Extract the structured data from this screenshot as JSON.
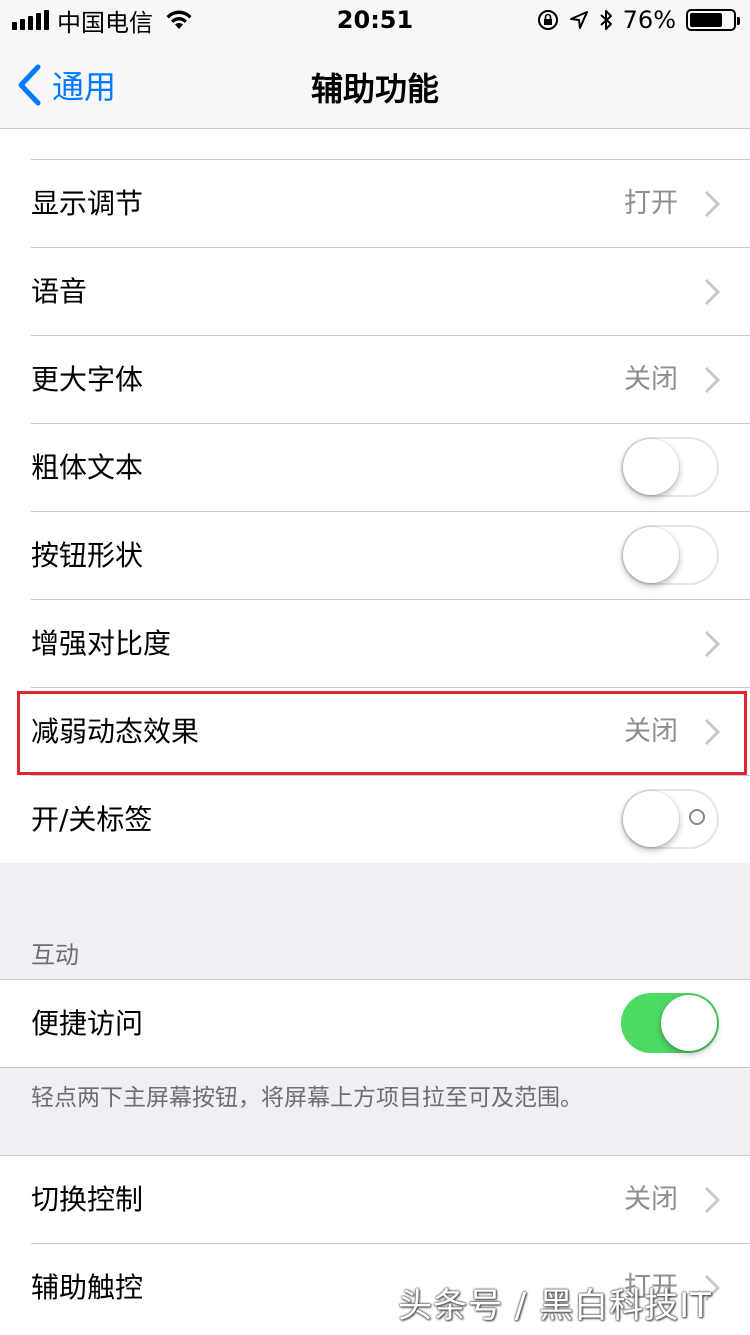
{
  "status_bar": {
    "carrier": "中国电信",
    "time": "20:51",
    "battery_percent": "76%",
    "battery_level": 0.76
  },
  "nav": {
    "back_label": "通用",
    "title": "辅助功能"
  },
  "main_group": {
    "rows": [
      {
        "label": "显示调节",
        "value": "打开",
        "accessory": "chevron"
      },
      {
        "label": "语音",
        "value": "",
        "accessory": "chevron"
      },
      {
        "label": "更大字体",
        "value": "关闭",
        "accessory": "chevron"
      },
      {
        "label": "粗体文本",
        "accessory": "toggle",
        "on": false
      },
      {
        "label": "按钮形状",
        "accessory": "toggle",
        "on": false
      },
      {
        "label": "增强对比度",
        "value": "",
        "accessory": "chevron"
      },
      {
        "label": "减弱动态效果",
        "value": "关闭",
        "accessory": "chevron",
        "highlighted": true
      },
      {
        "label": "开/关标签",
        "accessory": "toggle",
        "on": false
      }
    ]
  },
  "interaction_section": {
    "header": "互动",
    "row": {
      "label": "便捷访问",
      "accessory": "toggle",
      "on": true
    },
    "footer": "轻点两下主屏幕按钮，将屏幕上方项目拉至可及范围。"
  },
  "bottom_group": {
    "rows": [
      {
        "label": "切换控制",
        "value": "关闭",
        "accessory": "chevron"
      },
      {
        "label": "辅助触控",
        "value": "打开",
        "accessory": "chevron"
      }
    ]
  },
  "watermark": "头条号 / 黑白科技IT",
  "colors": {
    "ios_blue": "#007aff",
    "toggle_on": "#4cd964",
    "highlight_red": "#e0262f"
  }
}
